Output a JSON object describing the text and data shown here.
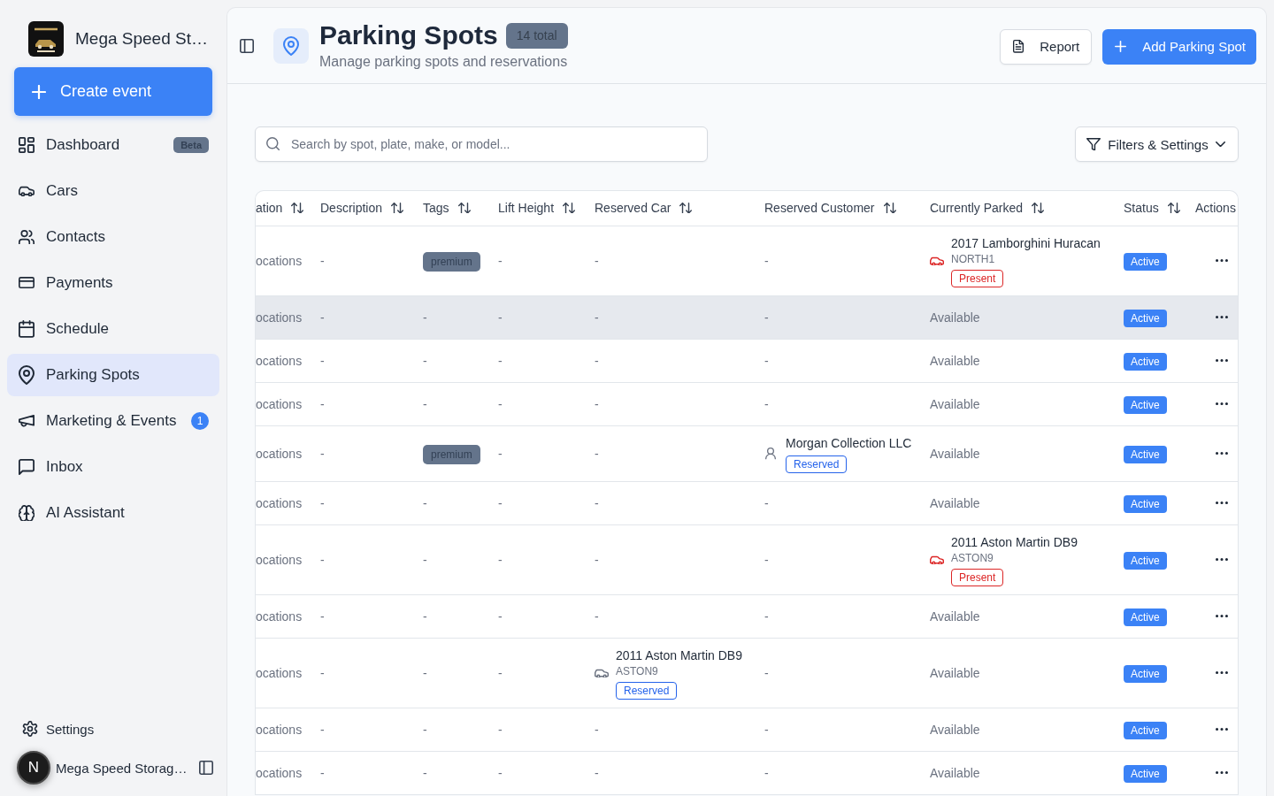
{
  "sidebar": {
    "brand": {
      "name": "Mega Speed St…"
    },
    "create_button": {
      "label": "Create event"
    },
    "items": [
      {
        "label": "Dashboard",
        "selected": false,
        "badge": {
          "kind": "label",
          "text": "Beta"
        }
      },
      {
        "label": "Cars",
        "selected": false
      },
      {
        "label": "Contacts",
        "selected": false
      },
      {
        "label": "Payments",
        "selected": false
      },
      {
        "label": "Schedule",
        "selected": false
      },
      {
        "label": "Parking Spots",
        "selected": true
      },
      {
        "label": "Marketing & Events",
        "selected": false,
        "badge": {
          "kind": "count",
          "text": "1"
        }
      },
      {
        "label": "Inbox",
        "selected": false
      },
      {
        "label": "AI Assistant",
        "selected": false
      }
    ],
    "settings": {
      "label": "Settings"
    },
    "account": {
      "initial": "N",
      "name": "Mega Speed Storag…"
    }
  },
  "header": {
    "title": "Parking Spots",
    "count_badge": "14 total",
    "subtitle": "Manage parking spots and reservations",
    "buttons": [
      {
        "kind": "outline",
        "label": "Report"
      },
      {
        "kind": "primary",
        "label": "Add Parking Spot"
      }
    ]
  },
  "search": {
    "placeholder": "Search by spot, plate, make, or model..."
  },
  "filters_button": {
    "label": "Filters & Settings"
  },
  "table": {
    "columns": [
      {
        "label": "ation",
        "sortable": true
      },
      {
        "label": "Description",
        "sortable": true
      },
      {
        "label": "Tags",
        "sortable": true
      },
      {
        "label": "Lift Height",
        "sortable": true
      },
      {
        "label": "Reserved Car",
        "sortable": true
      },
      {
        "label": "Reserved Customer",
        "sortable": true
      },
      {
        "label": "Currently Parked",
        "sortable": true
      },
      {
        "label": "Status",
        "sortable": true
      },
      {
        "label": "Actions"
      }
    ],
    "rows": [
      {
        "highlighted": false,
        "cells": [
          {
            "kind": "text",
            "text": "ocations"
          },
          {
            "kind": "text",
            "text": "-"
          },
          {
            "kind": "tag",
            "text": "premium"
          },
          {
            "kind": "text",
            "text": "-"
          },
          {
            "kind": "text",
            "text": "-"
          },
          {
            "kind": "text",
            "text": "-"
          },
          {
            "kind": "parked",
            "name": "2017 Lamborghini Huracan",
            "plate": "NORTH1",
            "badge": "Present"
          },
          {
            "kind": "status",
            "text": "Active"
          },
          {
            "kind": "actions"
          }
        ]
      },
      {
        "highlighted": true,
        "cells": [
          {
            "kind": "text",
            "text": "ocations"
          },
          {
            "kind": "text",
            "text": "-"
          },
          {
            "kind": "text",
            "text": "-"
          },
          {
            "kind": "text",
            "text": "-"
          },
          {
            "kind": "text",
            "text": "-"
          },
          {
            "kind": "text",
            "text": "-"
          },
          {
            "kind": "text",
            "text": "Available"
          },
          {
            "kind": "status",
            "text": "Active"
          },
          {
            "kind": "actions"
          }
        ]
      },
      {
        "highlighted": false,
        "cells": [
          {
            "kind": "text",
            "text": "ocations"
          },
          {
            "kind": "text",
            "text": "-"
          },
          {
            "kind": "text",
            "text": "-"
          },
          {
            "kind": "text",
            "text": "-"
          },
          {
            "kind": "text",
            "text": "-"
          },
          {
            "kind": "text",
            "text": "-"
          },
          {
            "kind": "text",
            "text": "Available"
          },
          {
            "kind": "status",
            "text": "Active"
          },
          {
            "kind": "actions"
          }
        ]
      },
      {
        "highlighted": false,
        "cells": [
          {
            "kind": "text",
            "text": "ocations"
          },
          {
            "kind": "text",
            "text": "-"
          },
          {
            "kind": "text",
            "text": "-"
          },
          {
            "kind": "text",
            "text": "-"
          },
          {
            "kind": "text",
            "text": "-"
          },
          {
            "kind": "text",
            "text": "-"
          },
          {
            "kind": "text",
            "text": "Available"
          },
          {
            "kind": "status",
            "text": "Active"
          },
          {
            "kind": "actions"
          }
        ]
      },
      {
        "highlighted": false,
        "cells": [
          {
            "kind": "text",
            "text": "ocations"
          },
          {
            "kind": "text",
            "text": "-"
          },
          {
            "kind": "tag",
            "text": "premium"
          },
          {
            "kind": "text",
            "text": "-"
          },
          {
            "kind": "text",
            "text": "-"
          },
          {
            "kind": "customer",
            "name": "Morgan Collection LLC",
            "badge": "Reserved"
          },
          {
            "kind": "text",
            "text": "Available"
          },
          {
            "kind": "status",
            "text": "Active"
          },
          {
            "kind": "actions"
          }
        ]
      },
      {
        "highlighted": false,
        "cells": [
          {
            "kind": "text",
            "text": "ocations"
          },
          {
            "kind": "text",
            "text": "-"
          },
          {
            "kind": "text",
            "text": "-"
          },
          {
            "kind": "text",
            "text": "-"
          },
          {
            "kind": "text",
            "text": "-"
          },
          {
            "kind": "text",
            "text": "-"
          },
          {
            "kind": "text",
            "text": "Available"
          },
          {
            "kind": "status",
            "text": "Active"
          },
          {
            "kind": "actions"
          }
        ]
      },
      {
        "highlighted": false,
        "cells": [
          {
            "kind": "text",
            "text": "ocations"
          },
          {
            "kind": "text",
            "text": "-"
          },
          {
            "kind": "text",
            "text": "-"
          },
          {
            "kind": "text",
            "text": "-"
          },
          {
            "kind": "text",
            "text": "-"
          },
          {
            "kind": "text",
            "text": "-"
          },
          {
            "kind": "parked",
            "name": "2011 Aston Martin DB9",
            "plate": "ASTON9",
            "badge": "Present"
          },
          {
            "kind": "status",
            "text": "Active"
          },
          {
            "kind": "actions"
          }
        ]
      },
      {
        "highlighted": false,
        "cells": [
          {
            "kind": "text",
            "text": "ocations"
          },
          {
            "kind": "text",
            "text": "-"
          },
          {
            "kind": "text",
            "text": "-"
          },
          {
            "kind": "text",
            "text": "-"
          },
          {
            "kind": "text",
            "text": "-"
          },
          {
            "kind": "text",
            "text": "-"
          },
          {
            "kind": "text",
            "text": "Available"
          },
          {
            "kind": "status",
            "text": "Active"
          },
          {
            "kind": "actions"
          }
        ]
      },
      {
        "highlighted": false,
        "cells": [
          {
            "kind": "text",
            "text": "ocations"
          },
          {
            "kind": "text",
            "text": "-"
          },
          {
            "kind": "text",
            "text": "-"
          },
          {
            "kind": "text",
            "text": "-"
          },
          {
            "kind": "reserved_car",
            "name": "2011 Aston Martin DB9",
            "plate": "ASTON9",
            "badge": "Reserved"
          },
          {
            "kind": "text",
            "text": "-"
          },
          {
            "kind": "text",
            "text": "Available"
          },
          {
            "kind": "status",
            "text": "Active"
          },
          {
            "kind": "actions"
          }
        ]
      },
      {
        "highlighted": false,
        "cells": [
          {
            "kind": "text",
            "text": "ocations"
          },
          {
            "kind": "text",
            "text": "-"
          },
          {
            "kind": "text",
            "text": "-"
          },
          {
            "kind": "text",
            "text": "-"
          },
          {
            "kind": "text",
            "text": "-"
          },
          {
            "kind": "text",
            "text": "-"
          },
          {
            "kind": "text",
            "text": "Available"
          },
          {
            "kind": "status",
            "text": "Active"
          },
          {
            "kind": "actions"
          }
        ]
      },
      {
        "highlighted": false,
        "cells": [
          {
            "kind": "text",
            "text": "ocations"
          },
          {
            "kind": "text",
            "text": "-"
          },
          {
            "kind": "text",
            "text": "-"
          },
          {
            "kind": "text",
            "text": "-"
          },
          {
            "kind": "text",
            "text": "-"
          },
          {
            "kind": "text",
            "text": "-"
          },
          {
            "kind": "text",
            "text": "Available"
          },
          {
            "kind": "status",
            "text": "Active"
          },
          {
            "kind": "actions"
          }
        ]
      }
    ]
  }
}
